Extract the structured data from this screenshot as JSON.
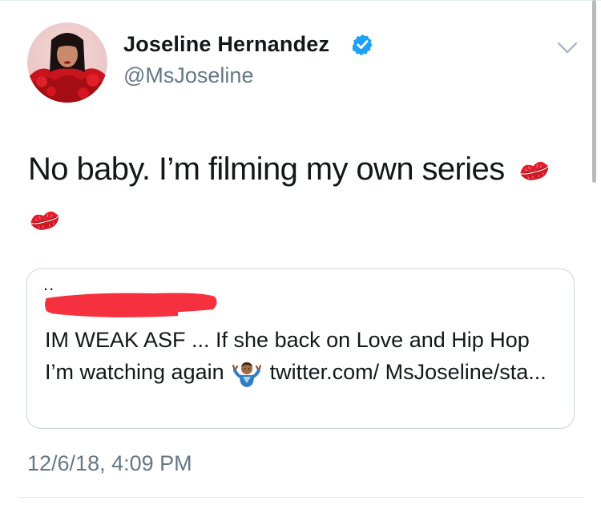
{
  "author": {
    "name": "Joseline Hernandez",
    "handle": "@MsJoseline",
    "verified": true,
    "avatar_icon": "profile-photo-red-outfit"
  },
  "tweet": {
    "text": "No baby. I’m filming my own series",
    "emoji": [
      "kiss-mark-icon",
      "kiss-mark-icon"
    ],
    "timestamp": "12/6/18, 4:09 PM"
  },
  "quoted_tweet": {
    "prefix": "..",
    "author_redacted": true,
    "text_part1": "IM WEAK ASF ... If she back on Love and Hip Hop I’m watching again",
    "emoji": "person-shrugging-icon",
    "text_part2": " twitter.com/ MsJoseline/sta..."
  },
  "colors": {
    "verified_blue": "#1da1f2",
    "secondary_text": "#657786",
    "border": "#ccd6dd",
    "redaction_red": "#f5303f",
    "kiss_red": "#e0202e"
  }
}
